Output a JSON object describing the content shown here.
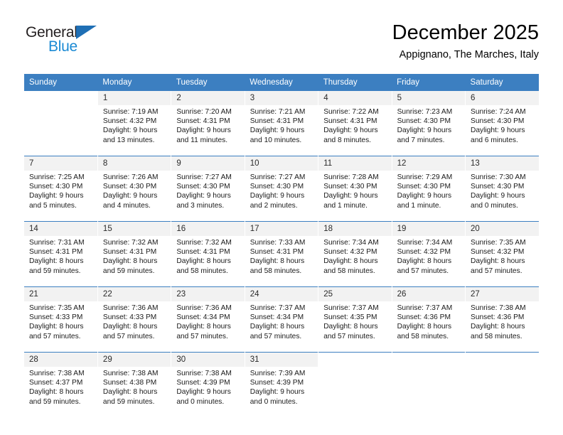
{
  "brand": {
    "name_top": "General",
    "name_bottom": "Blue",
    "triangle_icon": "triangle-icon",
    "color_dark": "#231f20",
    "color_blue": "#1b8ad4",
    "triangle_color": "#1f6fb5"
  },
  "header": {
    "title": "December 2025",
    "subtitle": "Appignano, The Marches, Italy"
  },
  "theme": {
    "header_bg": "#3c7fc1",
    "header_text": "#ffffff",
    "daynum_bg": "#f2f2f2",
    "cell_bg": "#ffffff"
  },
  "weekdays": [
    "Sunday",
    "Monday",
    "Tuesday",
    "Wednesday",
    "Thursday",
    "Friday",
    "Saturday"
  ],
  "weeks": [
    [
      {
        "day": "",
        "lines": []
      },
      {
        "day": "1",
        "lines": [
          "Sunrise: 7:19 AM",
          "Sunset: 4:32 PM",
          "Daylight: 9 hours",
          "and 13 minutes."
        ]
      },
      {
        "day": "2",
        "lines": [
          "Sunrise: 7:20 AM",
          "Sunset: 4:31 PM",
          "Daylight: 9 hours",
          "and 11 minutes."
        ]
      },
      {
        "day": "3",
        "lines": [
          "Sunrise: 7:21 AM",
          "Sunset: 4:31 PM",
          "Daylight: 9 hours",
          "and 10 minutes."
        ]
      },
      {
        "day": "4",
        "lines": [
          "Sunrise: 7:22 AM",
          "Sunset: 4:31 PM",
          "Daylight: 9 hours",
          "and 8 minutes."
        ]
      },
      {
        "day": "5",
        "lines": [
          "Sunrise: 7:23 AM",
          "Sunset: 4:30 PM",
          "Daylight: 9 hours",
          "and 7 minutes."
        ]
      },
      {
        "day": "6",
        "lines": [
          "Sunrise: 7:24 AM",
          "Sunset: 4:30 PM",
          "Daylight: 9 hours",
          "and 6 minutes."
        ]
      }
    ],
    [
      {
        "day": "7",
        "lines": [
          "Sunrise: 7:25 AM",
          "Sunset: 4:30 PM",
          "Daylight: 9 hours",
          "and 5 minutes."
        ]
      },
      {
        "day": "8",
        "lines": [
          "Sunrise: 7:26 AM",
          "Sunset: 4:30 PM",
          "Daylight: 9 hours",
          "and 4 minutes."
        ]
      },
      {
        "day": "9",
        "lines": [
          "Sunrise: 7:27 AM",
          "Sunset: 4:30 PM",
          "Daylight: 9 hours",
          "and 3 minutes."
        ]
      },
      {
        "day": "10",
        "lines": [
          "Sunrise: 7:27 AM",
          "Sunset: 4:30 PM",
          "Daylight: 9 hours",
          "and 2 minutes."
        ]
      },
      {
        "day": "11",
        "lines": [
          "Sunrise: 7:28 AM",
          "Sunset: 4:30 PM",
          "Daylight: 9 hours",
          "and 1 minute."
        ]
      },
      {
        "day": "12",
        "lines": [
          "Sunrise: 7:29 AM",
          "Sunset: 4:30 PM",
          "Daylight: 9 hours",
          "and 1 minute."
        ]
      },
      {
        "day": "13",
        "lines": [
          "Sunrise: 7:30 AM",
          "Sunset: 4:30 PM",
          "Daylight: 9 hours",
          "and 0 minutes."
        ]
      }
    ],
    [
      {
        "day": "14",
        "lines": [
          "Sunrise: 7:31 AM",
          "Sunset: 4:31 PM",
          "Daylight: 8 hours",
          "and 59 minutes."
        ]
      },
      {
        "day": "15",
        "lines": [
          "Sunrise: 7:32 AM",
          "Sunset: 4:31 PM",
          "Daylight: 8 hours",
          "and 59 minutes."
        ]
      },
      {
        "day": "16",
        "lines": [
          "Sunrise: 7:32 AM",
          "Sunset: 4:31 PM",
          "Daylight: 8 hours",
          "and 58 minutes."
        ]
      },
      {
        "day": "17",
        "lines": [
          "Sunrise: 7:33 AM",
          "Sunset: 4:31 PM",
          "Daylight: 8 hours",
          "and 58 minutes."
        ]
      },
      {
        "day": "18",
        "lines": [
          "Sunrise: 7:34 AM",
          "Sunset: 4:32 PM",
          "Daylight: 8 hours",
          "and 58 minutes."
        ]
      },
      {
        "day": "19",
        "lines": [
          "Sunrise: 7:34 AM",
          "Sunset: 4:32 PM",
          "Daylight: 8 hours",
          "and 57 minutes."
        ]
      },
      {
        "day": "20",
        "lines": [
          "Sunrise: 7:35 AM",
          "Sunset: 4:32 PM",
          "Daylight: 8 hours",
          "and 57 minutes."
        ]
      }
    ],
    [
      {
        "day": "21",
        "lines": [
          "Sunrise: 7:35 AM",
          "Sunset: 4:33 PM",
          "Daylight: 8 hours",
          "and 57 minutes."
        ]
      },
      {
        "day": "22",
        "lines": [
          "Sunrise: 7:36 AM",
          "Sunset: 4:33 PM",
          "Daylight: 8 hours",
          "and 57 minutes."
        ]
      },
      {
        "day": "23",
        "lines": [
          "Sunrise: 7:36 AM",
          "Sunset: 4:34 PM",
          "Daylight: 8 hours",
          "and 57 minutes."
        ]
      },
      {
        "day": "24",
        "lines": [
          "Sunrise: 7:37 AM",
          "Sunset: 4:34 PM",
          "Daylight: 8 hours",
          "and 57 minutes."
        ]
      },
      {
        "day": "25",
        "lines": [
          "Sunrise: 7:37 AM",
          "Sunset: 4:35 PM",
          "Daylight: 8 hours",
          "and 57 minutes."
        ]
      },
      {
        "day": "26",
        "lines": [
          "Sunrise: 7:37 AM",
          "Sunset: 4:36 PM",
          "Daylight: 8 hours",
          "and 58 minutes."
        ]
      },
      {
        "day": "27",
        "lines": [
          "Sunrise: 7:38 AM",
          "Sunset: 4:36 PM",
          "Daylight: 8 hours",
          "and 58 minutes."
        ]
      }
    ],
    [
      {
        "day": "28",
        "lines": [
          "Sunrise: 7:38 AM",
          "Sunset: 4:37 PM",
          "Daylight: 8 hours",
          "and 59 minutes."
        ]
      },
      {
        "day": "29",
        "lines": [
          "Sunrise: 7:38 AM",
          "Sunset: 4:38 PM",
          "Daylight: 8 hours",
          "and 59 minutes."
        ]
      },
      {
        "day": "30",
        "lines": [
          "Sunrise: 7:38 AM",
          "Sunset: 4:39 PM",
          "Daylight: 9 hours",
          "and 0 minutes."
        ]
      },
      {
        "day": "31",
        "lines": [
          "Sunrise: 7:39 AM",
          "Sunset: 4:39 PM",
          "Daylight: 9 hours",
          "and 0 minutes."
        ]
      },
      {
        "day": "",
        "lines": []
      },
      {
        "day": "",
        "lines": []
      },
      {
        "day": "",
        "lines": []
      }
    ]
  ]
}
